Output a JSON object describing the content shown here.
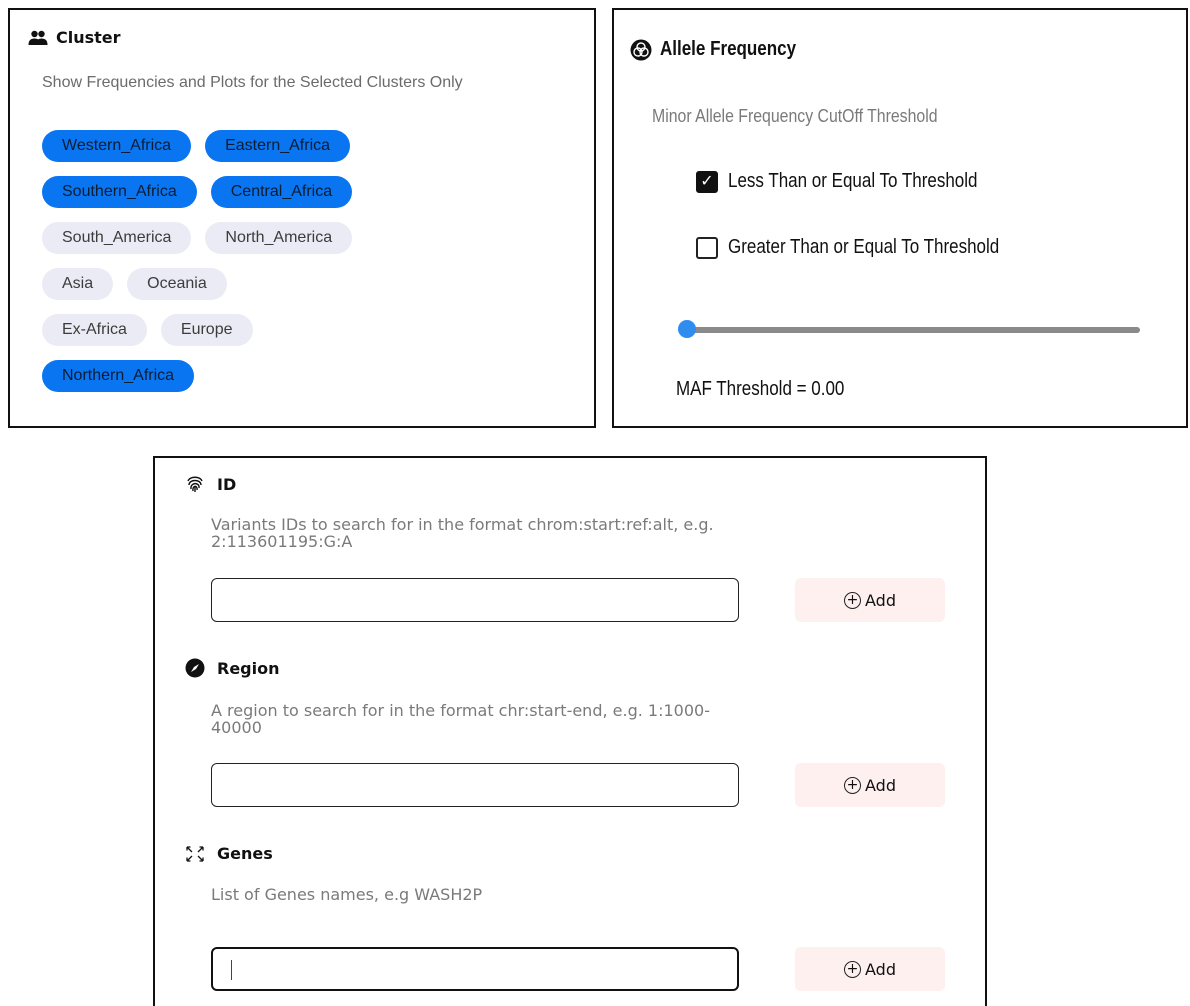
{
  "cluster": {
    "title": "Cluster",
    "icon": "users-icon",
    "description": "Show Frequencies and Plots for the Selected Clusters Only",
    "selected_color": "#0a75f0",
    "unselected_color": "#ebebf5",
    "rows": [
      [
        {
          "label": "Western_Africa",
          "selected": true
        },
        {
          "label": "Eastern_Africa",
          "selected": true
        }
      ],
      [
        {
          "label": "Southern_Africa",
          "selected": true
        },
        {
          "label": "Central_Africa",
          "selected": true
        }
      ],
      [
        {
          "label": "South_America",
          "selected": false
        },
        {
          "label": "North_America",
          "selected": false
        }
      ],
      [
        {
          "label": "Asia",
          "selected": false
        },
        {
          "label": "Oceania",
          "selected": false
        }
      ],
      [
        {
          "label": "Ex-Africa",
          "selected": false
        },
        {
          "label": "Europe",
          "selected": false
        }
      ],
      [
        {
          "label": "Northern_Africa",
          "selected": true
        }
      ]
    ]
  },
  "allele": {
    "title": "Allele Frequency",
    "icon": "venn-circles-icon",
    "description": "Minor Allele Frequency CutOff Threshold",
    "option_le": {
      "label": "Less Than or Equal To Threshold",
      "checked": true
    },
    "option_ge": {
      "label": "Greater Than or Equal To Threshold",
      "checked": false
    },
    "slider": {
      "min": 0,
      "max": 1,
      "value": 0.0
    },
    "maf_text": "MAF Threshold = 0.00",
    "accent": "#2f8df0"
  },
  "search": {
    "id": {
      "title": "ID",
      "icon": "fingerprint-icon",
      "desc_line1": "Variants IDs to search for in the format chrom:start:ref:alt, e.g.",
      "desc_line2": "2:113601195:G:A",
      "value": "",
      "add_label": "Add"
    },
    "region": {
      "title": "Region",
      "icon": "compass-icon",
      "desc_line1": "A region to search for in the format chr:start-end, e.g. 1:1000-",
      "desc_line2": "40000",
      "value": "",
      "add_label": "Add"
    },
    "genes": {
      "title": "Genes",
      "icon": "expand-arrows-icon",
      "desc_line1": "List of Genes names, e.g WASH2P",
      "value": "",
      "add_label": "Add"
    }
  }
}
